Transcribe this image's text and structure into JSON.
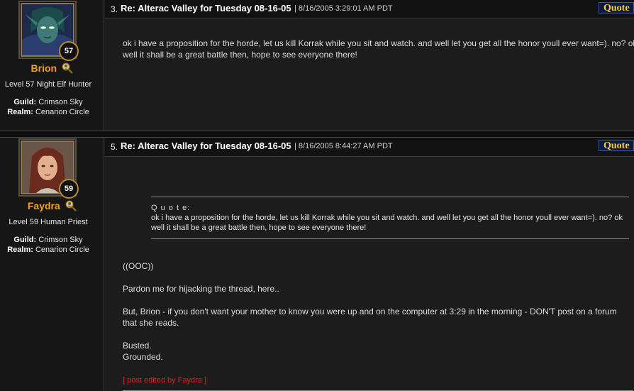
{
  "colors": {
    "background": "#1a1a1a",
    "character_name": "#f0a028",
    "quote_button_text": "#ffcc33",
    "quote_button_bg": "#0b1a3d",
    "edited_text": "#dd2222"
  },
  "posts": [
    {
      "number": "3.",
      "title": "Re: Alterac Valley for Tuesday 08-16-05",
      "date": "| 8/16/2005 3:29:01 AM PDT",
      "quote_button": "Quote",
      "author": {
        "name": "Brion",
        "level_badge": "57",
        "description": "Level 57 Night Elf Hunter",
        "guild_label": "Guild:",
        "guild": "Crimson Sky",
        "realm_label": "Realm:",
        "realm": "Cenarion Circle",
        "avatar_icon": "night-elf-portrait",
        "profile_icon": "magnifier-profile-icon"
      },
      "body_lines": [
        "ok i have a proposition for the horde, let us kill Korrak while you sit and watch. and well let you get all the honor youll ever want=). no? ok well it shall be a great battle then, hope to see everyone there!"
      ]
    },
    {
      "number": "5.",
      "title": "Re: Alterac Valley for Tuesday 08-16-05",
      "date": "| 8/16/2005 8:44:27 AM PDT",
      "quote_button": "Quote",
      "author": {
        "name": "Faydra",
        "level_badge": "59",
        "description": "Level 59 Human Priest",
        "guild_label": "Guild:",
        "guild": "Crimson Sky",
        "realm_label": "Realm:",
        "realm": "Cenarion Circle",
        "avatar_icon": "human-female-portrait",
        "profile_icon": "magnifier-profile-icon"
      },
      "quote": {
        "label": "Q u o t e:",
        "text": "ok i have a proposition for the horde, let us kill Korrak while you sit and watch. and well let you get all the honor youll ever want=). no? ok well it shall be a great battle then, hope to see everyone there!"
      },
      "body": {
        "line1": "((OOC))",
        "line2": "Pardon me for hijacking the thread, here..",
        "line3": "But, Brion - if you don't want your mother to know you were up and on the computer at 3:29 in the morning - DON'T post on a forum that she reads.",
        "line4": "Busted.",
        "line5": "Grounded."
      },
      "edited_note": "[ post edited by Faydra ]"
    }
  ]
}
